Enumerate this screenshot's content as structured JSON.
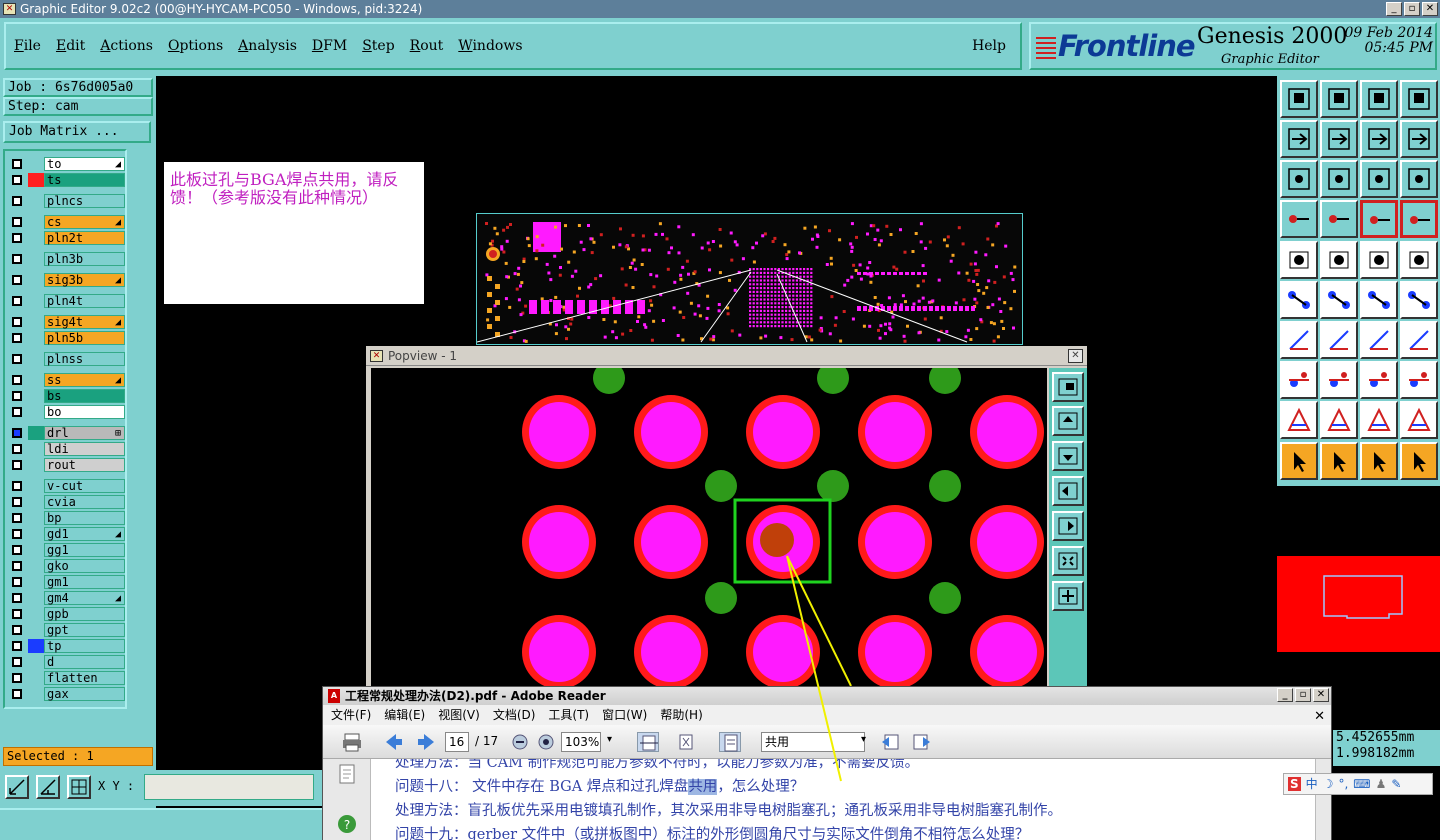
{
  "window": {
    "title": "Graphic Editor 9.02c2 (00@HY-HYCAM-PC050 - Windows, pid:3224)",
    "min": "_",
    "max": "▫",
    "close": "✕"
  },
  "menu": {
    "items": [
      "File",
      "Edit",
      "Actions",
      "Options",
      "Analysis",
      "DFM",
      "Step",
      "Rout",
      "Windows"
    ],
    "help": "Help"
  },
  "brand": {
    "logo": "Frontline",
    "product": "Genesis 2000",
    "subtitle": "Graphic Editor",
    "date": "09 Feb 2014",
    "time": "05:45 PM"
  },
  "left": {
    "job": "Job : 6s76d005a0",
    "step": "Step: cam",
    "job_matrix": "Job Matrix ...",
    "layers": [
      {
        "name": "to",
        "bg": "#ffffff",
        "swatch": "",
        "mark": "◢"
      },
      {
        "name": "ts",
        "bg": "#1aa17f",
        "swatch": "#ff2020",
        "mark": ""
      },
      {
        "name": "plncs",
        "bg": "#7fd0cf",
        "swatch": "",
        "mark": ""
      },
      {
        "name": "cs",
        "bg": "#f5a623",
        "swatch": "",
        "mark": "◢"
      },
      {
        "name": "pln2t",
        "bg": "#f5a623",
        "swatch": "",
        "mark": ""
      },
      {
        "name": "pln3b",
        "bg": "#7fd0cf",
        "swatch": "",
        "mark": ""
      },
      {
        "name": "sig3b",
        "bg": "#f5a623",
        "swatch": "",
        "mark": "◢"
      },
      {
        "name": "pln4t",
        "bg": "#7fd0cf",
        "swatch": "",
        "mark": ""
      },
      {
        "name": "sig4t",
        "bg": "#f5a623",
        "swatch": "",
        "mark": "◢"
      },
      {
        "name": "pln5b",
        "bg": "#f5a623",
        "swatch": "",
        "mark": ""
      },
      {
        "name": "plnss",
        "bg": "#7fd0cf",
        "swatch": "",
        "mark": ""
      },
      {
        "name": "ss",
        "bg": "#f5a623",
        "swatch": "",
        "mark": "◢"
      },
      {
        "name": "bs",
        "bg": "#1aa17f",
        "swatch": "",
        "mark": ""
      },
      {
        "name": "bo",
        "bg": "#ffffff",
        "swatch": "",
        "mark": ""
      },
      {
        "name": "drl",
        "bg": "#b9b9b9",
        "swatch": "#1aa17f",
        "mark": "⊞"
      },
      {
        "name": "ldi",
        "bg": "#cfcfcf",
        "swatch": "",
        "mark": ""
      },
      {
        "name": "rout",
        "bg": "#cfcfcf",
        "swatch": "",
        "mark": ""
      },
      {
        "name": "v-cut",
        "bg": "#7fd0cf",
        "swatch": "",
        "mark": ""
      },
      {
        "name": "cvia",
        "bg": "#7fd0cf",
        "swatch": "",
        "mark": ""
      },
      {
        "name": "bp",
        "bg": "#7fd0cf",
        "swatch": "",
        "mark": ""
      },
      {
        "name": "gd1",
        "bg": "#7fd0cf",
        "swatch": "",
        "mark": "◢"
      },
      {
        "name": "gg1",
        "bg": "#7fd0cf",
        "swatch": "",
        "mark": ""
      },
      {
        "name": "gko",
        "bg": "#7fd0cf",
        "swatch": "",
        "mark": ""
      },
      {
        "name": "gm1",
        "bg": "#7fd0cf",
        "swatch": "",
        "mark": ""
      },
      {
        "name": "gm4",
        "bg": "#7fd0cf",
        "swatch": "",
        "mark": "◢"
      },
      {
        "name": "gpb",
        "bg": "#7fd0cf",
        "swatch": "",
        "mark": ""
      },
      {
        "name": "gpt",
        "bg": "#7fd0cf",
        "swatch": "",
        "mark": ""
      },
      {
        "name": "tp",
        "bg": "#7fd0cf",
        "swatch": "#1a3cff",
        "mark": ""
      },
      {
        "name": "d",
        "bg": "#7fd0cf",
        "swatch": "",
        "mark": ""
      },
      {
        "name": "flatten",
        "bg": "#7fd0cf",
        "swatch": "",
        "mark": ""
      },
      {
        "name": "gax",
        "bg": "#7fd0cf",
        "swatch": "",
        "mark": ""
      }
    ],
    "selected": "Selected : 1"
  },
  "bottom": {
    "xy_label": "X Y :",
    "xy_value": ""
  },
  "note": {
    "text": "此板过孔与BGA焊点共用，请反馈！（参考版没有此种情况）"
  },
  "popview": {
    "title": "Popview - 1",
    "close": "✕"
  },
  "coords": {
    "x": "5.452655mm",
    "y": "1.998182mm"
  },
  "ime": {
    "items": [
      "S",
      "中",
      "☽",
      "°,",
      "⌨",
      "♟",
      "✎"
    ]
  },
  "reader": {
    "title": "工程常规处理办法(D2).pdf - Adobe Reader",
    "menu": [
      "文件(F)",
      "编辑(E)",
      "视图(V)",
      "文档(D)",
      "工具(T)",
      "窗口(W)",
      "帮助(H)"
    ],
    "page": "16",
    "page_total": "/ 17",
    "zoom": "103%",
    "search": "共用",
    "lines": {
      "line0": "处理方法：当 CAM 制作规范可能方参数不符时，以能力参数为准，不需要反馈。",
      "line1_pre": "问题十八：  文件中存在 BGA 焊点和过孔焊盘",
      "line1_hl": "共用",
      "line1_post": "，怎么处理？",
      "line2": "处理方法：盲孔板优先采用电镀填孔制作，其次采用非导电树脂塞孔；通孔板采用非导电树脂塞孔制作。",
      "line3": "问题十九：gerber 文件中（或拼板图中）标注的外形倒圆角尺寸与实际文件倒角不相符怎么处理？"
    }
  },
  "colors": {
    "panel": "#7fd0cf",
    "pad_ring": "#ff1a1a",
    "pad_fill": "#ff1aff",
    "via": "#2e9a1a",
    "selected_box": "#1fd31f",
    "drill": "#c0400a",
    "arrow": "#f0f000"
  }
}
